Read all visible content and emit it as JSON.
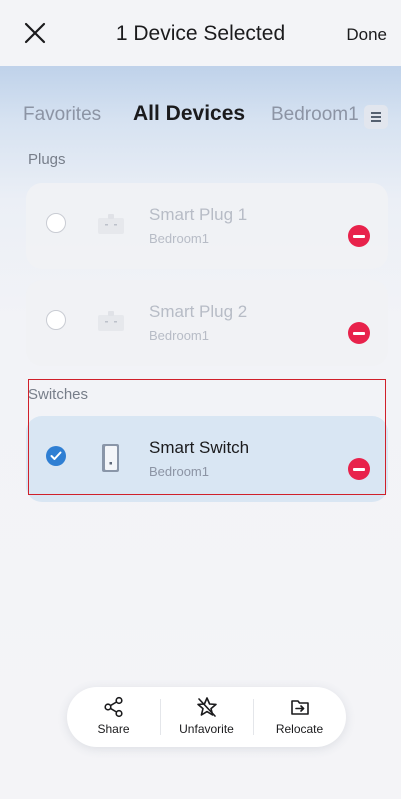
{
  "header": {
    "title": "1 Device Selected",
    "done_label": "Done",
    "close_icon": "close-icon"
  },
  "tabs": [
    {
      "label": "Favorites",
      "active": false
    },
    {
      "label": "All Devices",
      "active": true
    },
    {
      "label": "Bedroom1",
      "active": false
    }
  ],
  "tab_menu_icon": "menu-icon",
  "sections": {
    "plugs": {
      "label": "Plugs",
      "devices": [
        {
          "name": "Smart Plug 1",
          "room": "Bedroom1",
          "selected": false,
          "icon": "plug-icon"
        },
        {
          "name": "Smart Plug 2",
          "room": "Bedroom1",
          "selected": false,
          "icon": "plug-icon"
        }
      ]
    },
    "switches": {
      "label": "Switches",
      "devices": [
        {
          "name": "Smart Switch",
          "room": "Bedroom1",
          "selected": true,
          "icon": "switch-icon"
        }
      ]
    }
  },
  "actions": [
    {
      "label": "Share",
      "icon": "share-icon"
    },
    {
      "label": "Unfavorite",
      "icon": "unfavorite-star-icon"
    },
    {
      "label": "Relocate",
      "icon": "relocate-folder-icon"
    }
  ],
  "colors": {
    "accent": "#2f7fd3",
    "remove": "#e8224b",
    "highlight": "#d0202a"
  }
}
